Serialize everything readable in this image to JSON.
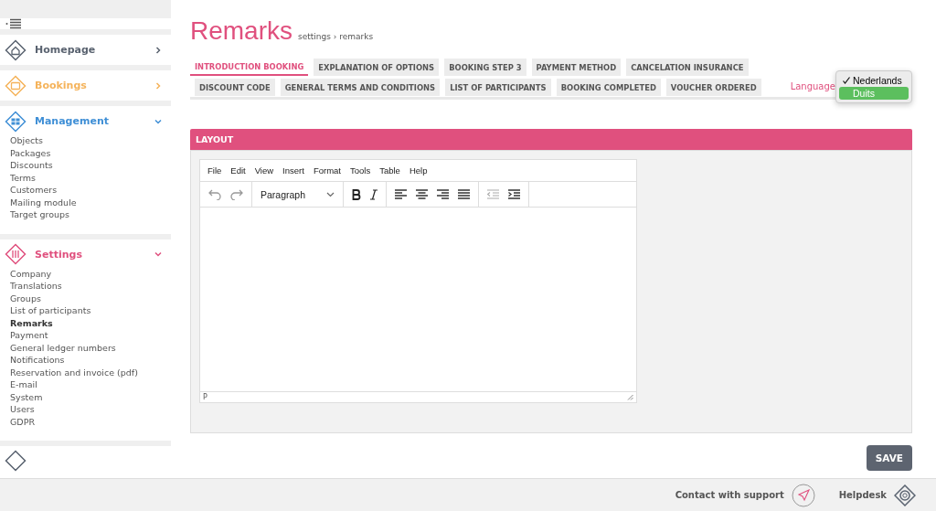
{
  "sidebar": {
    "sections": [
      {
        "kind": "home",
        "label": "Homepage",
        "color": "#5a6370",
        "expanded": false
      },
      {
        "kind": "calendar",
        "label": "Bookings",
        "color": "#f5b35a",
        "expanded": false
      },
      {
        "kind": "grid",
        "label": "Management",
        "color": "#3f8fd6",
        "expanded": true,
        "items": [
          {
            "label": "Objects",
            "selected": false
          },
          {
            "label": "Packages",
            "selected": false
          },
          {
            "label": "Discounts",
            "selected": false
          },
          {
            "label": "Terms",
            "selected": false
          },
          {
            "label": "Customers",
            "selected": false
          },
          {
            "label": "Mailing module",
            "selected": false
          },
          {
            "label": "Target groups",
            "selected": false
          }
        ]
      },
      {
        "kind": "tools",
        "label": "Settings",
        "color": "#e0507e",
        "expanded": true,
        "items": [
          {
            "label": "Company",
            "selected": false
          },
          {
            "label": "Translations",
            "selected": false
          },
          {
            "label": "Groups",
            "selected": false
          },
          {
            "label": "List of participants",
            "selected": false
          },
          {
            "label": "Remarks",
            "selected": true
          },
          {
            "label": "Payment",
            "selected": false
          },
          {
            "label": "General ledger numbers",
            "selected": false
          },
          {
            "label": "Notifications",
            "selected": false
          },
          {
            "label": "Reservation and invoice (pdf)",
            "selected": false
          },
          {
            "label": "E-mail",
            "selected": false
          },
          {
            "label": "System",
            "selected": false
          },
          {
            "label": "Users",
            "selected": false
          },
          {
            "label": "GDPR",
            "selected": false
          }
        ]
      }
    ]
  },
  "page": {
    "title": "Remarks",
    "breadcrumb": "settings › remarks"
  },
  "tabs": [
    [
      {
        "label": "INTRODUCTION BOOKING",
        "selected": true
      },
      {
        "label": "EXPLANATION OF OPTIONS",
        "selected": false
      },
      {
        "label": "BOOKING STEP 3",
        "selected": false
      },
      {
        "label": "PAYMENT METHOD",
        "selected": false
      },
      {
        "label": "CANCELATION INSURANCE",
        "selected": false
      }
    ],
    [
      {
        "label": "DISCOUNT CODE",
        "selected": false
      },
      {
        "label": "GENERAL TERMS AND CONDITIONS",
        "selected": false
      },
      {
        "label": "LIST OF PARTICIPANTS",
        "selected": false
      },
      {
        "label": "BOOKING COMPLETED",
        "selected": false
      },
      {
        "label": "VOUCHER ORDERED",
        "selected": false
      }
    ]
  ],
  "language": {
    "label": "Language",
    "options": [
      {
        "label": "Nederlands",
        "checked": true,
        "highlighted": false
      },
      {
        "label": "Duits",
        "checked": false,
        "highlighted": true
      }
    ]
  },
  "panel": {
    "title": "LAYOUT",
    "editor": {
      "menu": [
        "File",
        "Edit",
        "View",
        "Insert",
        "Format",
        "Tools",
        "Table",
        "Help"
      ],
      "block_format": "Paragraph",
      "status_path": "P"
    }
  },
  "save_button": "SAVE",
  "footer": {
    "support": "Contact with support",
    "helpdesk": "Helpdesk"
  }
}
